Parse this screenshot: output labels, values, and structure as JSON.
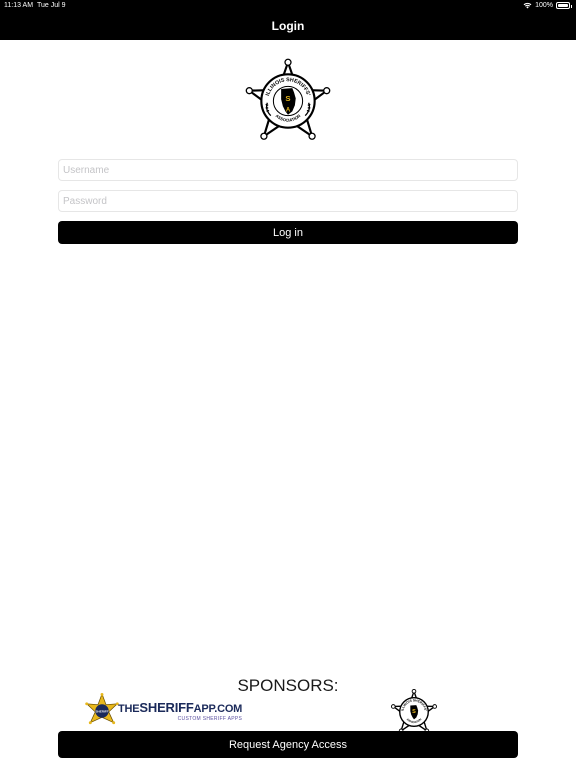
{
  "status_bar": {
    "time": "11:13 AM",
    "date": "Tue Jul 9",
    "battery": "100%",
    "battery_level": 1.0,
    "wifi_icon": "wifi-icon",
    "battery_icon": "battery-icon"
  },
  "nav": {
    "title": "Login"
  },
  "logo": {
    "ring_text_top": "ILLINOIS SHERIFFS'",
    "ring_text_bottom": "ASSOCIATION",
    "center_letters": "ISA"
  },
  "form": {
    "username_placeholder": "Username",
    "username_value": "",
    "password_placeholder": "Password",
    "password_value": "",
    "login_label": "Log in"
  },
  "sponsors": {
    "heading": "SPONSORS:",
    "items": [
      {
        "name_prefix": "THE",
        "name_main": "SHERIFF",
        "name_suffix": "APP.COM",
        "tagline": "CUSTOM SHERIFF APPS",
        "badge_text": "SHERIFF"
      },
      {
        "name": "ILLINOIS SHERIFFS' ASSOCIATION",
        "center_letters": "ISA"
      }
    ]
  },
  "request_access_label": "Request Agency Access",
  "colors": {
    "bar": "#000000",
    "background": "#ffffff",
    "field_border": "#e6e6e6",
    "sponsor_gold": "#e8b81c",
    "sponsor_navy": "#1b2a5a"
  }
}
